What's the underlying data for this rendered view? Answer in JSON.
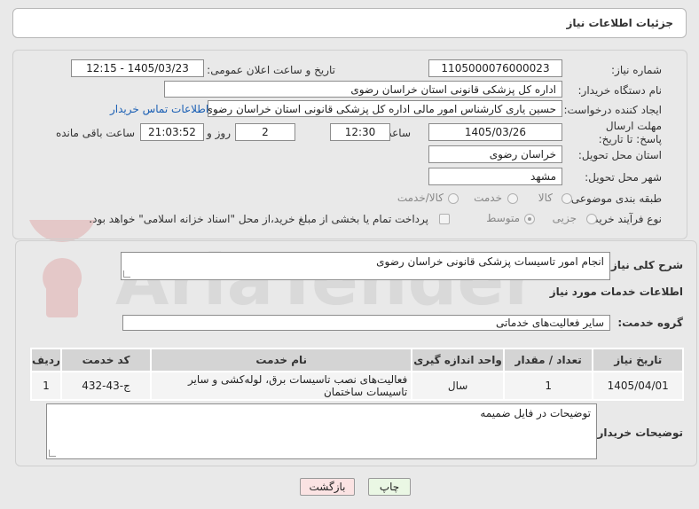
{
  "header": {
    "title": "جزئیات اطلاعات نیاز"
  },
  "fields": {
    "need_number_label": "شماره نیاز:",
    "need_number": "1105000076000023",
    "announce_label": "تاریخ و ساعت اعلان عمومی:",
    "announce_value": "1405/03/23 - 12:15",
    "buyer_label": "نام دستگاه خریدار:",
    "buyer_value": "اداره کل پزشکی قانونی استان خراسان رضوی",
    "creator_label": "ایجاد کننده درخواست:",
    "creator_value": "حسین یاری کارشناس امور مالی اداره کل پزشکی قانونی استان خراسان رضوی",
    "contact_link": "اطلاعات تماس خریدار",
    "deadline_label": "مهلت ارسال پاسخ: تا تاریخ:",
    "deadline_date": "1405/03/26",
    "time_label": "ساعت",
    "deadline_time": "12:30",
    "days_value": "2",
    "days_label": "روز و",
    "remaining_time": "21:03:52",
    "remaining_label": "ساعت باقی مانده",
    "province_label": "استان محل تحویل:",
    "province_value": "خراسان رضوی",
    "city_label": "شهر محل تحویل:",
    "city_value": "مشهد",
    "category_label": "طبقه بندی موضوعی:",
    "category_options": [
      "کالا",
      "خدمت",
      "کالا/خدمت"
    ],
    "process_label": "نوع فرآیند خرید :",
    "process_options": [
      "جزیی",
      "متوسط"
    ],
    "payment_note": "پرداخت تمام یا بخشی از مبلغ خرید،از محل \"اسناد خزانه اسلامی\" خواهد بود."
  },
  "description": {
    "label": "شرح کلی نیاز:",
    "value": "انجام امور تاسیسات پزشکی قانونی خراسان رضوی"
  },
  "services": {
    "section_title": "اطلاعات خدمات مورد نیاز",
    "group_label": "گروه خدمت:",
    "group_value": "سایر فعالیت‌های خدماتی",
    "columns": [
      "ردیف",
      "کد خدمت",
      "نام خدمت",
      "واحد اندازه گیری",
      "تعداد / مقدار",
      "تاریخ نیاز"
    ],
    "rows": [
      [
        "1",
        "ج-43-432",
        "فعالیت‌های نصب تاسیسات برق، لوله‌کشی و سایر تاسیسات ساختمان",
        "سال",
        "1",
        "1405/04/01"
      ]
    ]
  },
  "buyer_notes": {
    "label": "توضیحات خریدار:",
    "value": "توضیحات در فایل ضمیمه"
  },
  "buttons": {
    "print": "چاپ",
    "back": "بازگشت"
  },
  "watermark": {
    "text": "AriaTender.net"
  },
  "colors": {
    "link": "#1a5fb4",
    "back_button_bg": "#fbe3e3",
    "print_button_bg": "#eaf7e4",
    "table_header": "#d4d4d4"
  }
}
